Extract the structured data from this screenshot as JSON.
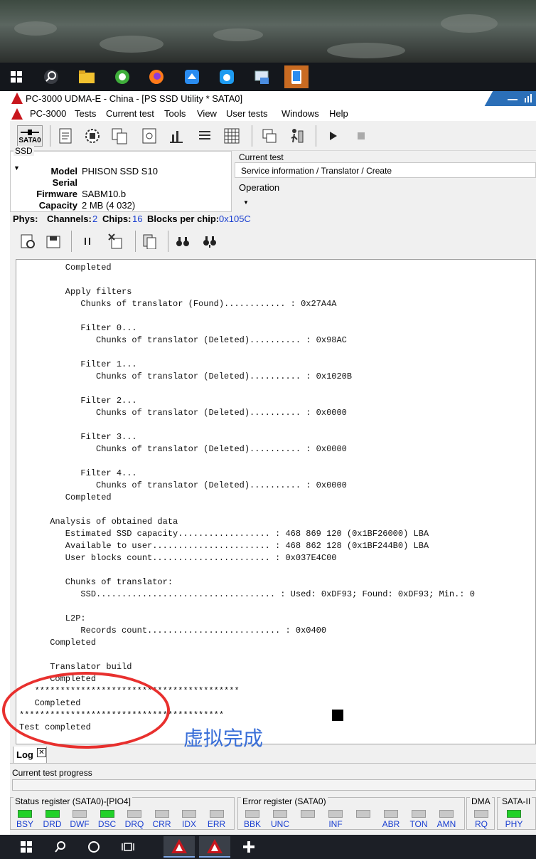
{
  "window": {
    "title": "PC-3000 UDMA-E - China - [PS SSD Utility * SATA0]"
  },
  "menu": [
    "PC-3000",
    "Tests",
    "Current test",
    "Tools",
    "View",
    "User tests",
    "Windows",
    "Help"
  ],
  "toolbar": {
    "sata_label": "SATA0"
  },
  "ssd": {
    "group_label": "SSD",
    "fields": [
      {
        "key": "Model",
        "value": "PHISON SSD S10"
      },
      {
        "key": "Serial",
        "value": ""
      },
      {
        "key": "Firmware",
        "value": "SABM10.b"
      },
      {
        "key": "Capacity",
        "value": "2 MB (4 032)"
      }
    ]
  },
  "current_test": {
    "label": "Current test",
    "value": "Service information / Translator / Create"
  },
  "operation": {
    "label": "Operation",
    "value": ""
  },
  "phys": {
    "label": "Phys:",
    "channels_label": "Channels:",
    "channels": "2",
    "chips_label": "Chips:",
    "chips": "16",
    "blocks_label": "Blocks per chip:",
    "blocks": "0x105C"
  },
  "log": {
    "lines": [
      "         Completed",
      "",
      "         Apply filters",
      "            Chunks of translator (Found)............ : 0x27A4A",
      "",
      "            Filter 0...",
      "               Chunks of translator (Deleted).......... : 0x98AC",
      "",
      "            Filter 1...",
      "               Chunks of translator (Deleted).......... : 0x1020B",
      "",
      "            Filter 2...",
      "               Chunks of translator (Deleted).......... : 0x0000",
      "",
      "            Filter 3...",
      "               Chunks of translator (Deleted).......... : 0x0000",
      "",
      "            Filter 4...",
      "               Chunks of translator (Deleted).......... : 0x0000",
      "         Completed",
      "",
      "      Analysis of obtained data",
      "         Estimated SSD capacity.................. : 468 869 120 (0x1BF26000) LBA",
      "         Available to user....................... : 468 862 128 (0x1BF244B0) LBA",
      "         User blocks count....................... : 0x037E4C00",
      "",
      "         Chunks of translator:",
      "            SSD................................... : Used: 0xDF93; Found: 0xDF93; Min.: 0",
      "",
      "         L2P:",
      "            Records count.......................... : 0x0400",
      "      Completed",
      "",
      "      Translator build",
      "      Completed",
      "   ****************************************",
      "   Completed",
      "****************************************",
      "Test completed"
    ],
    "tab_label": "Log",
    "annotation": "虚拟完成"
  },
  "progress": {
    "label": "Current test progress",
    "value": 0
  },
  "registers": {
    "status": {
      "title": "Status register (SATA0)-[PIO4]",
      "bits": [
        {
          "name": "BSY",
          "on": true
        },
        {
          "name": "DRD",
          "on": true
        },
        {
          "name": "DWF",
          "on": false
        },
        {
          "name": "DSC",
          "on": true
        },
        {
          "name": "DRQ",
          "on": false
        },
        {
          "name": "CRR",
          "on": false
        },
        {
          "name": "IDX",
          "on": false
        },
        {
          "name": "ERR",
          "on": false
        }
      ]
    },
    "error": {
      "title": "Error register (SATA0)",
      "bits": [
        {
          "name": "BBK",
          "on": false
        },
        {
          "name": "UNC",
          "on": false
        },
        {
          "name": "",
          "on": false
        },
        {
          "name": "INF",
          "on": false
        },
        {
          "name": "",
          "on": false
        },
        {
          "name": "ABR",
          "on": false
        },
        {
          "name": "TON",
          "on": false
        },
        {
          "name": "AMN",
          "on": false
        }
      ]
    },
    "dma": {
      "title": "DMA",
      "bits": [
        {
          "name": "RQ",
          "on": false
        }
      ]
    },
    "sata": {
      "title": "SATA-II",
      "bits": [
        {
          "name": "PHY",
          "on": true
        }
      ]
    }
  },
  "colors": {
    "led_on": "#21d128",
    "led_off": "#c8c8c8",
    "annotation": "#e8302e",
    "link_blue": "#1a3fd0"
  }
}
